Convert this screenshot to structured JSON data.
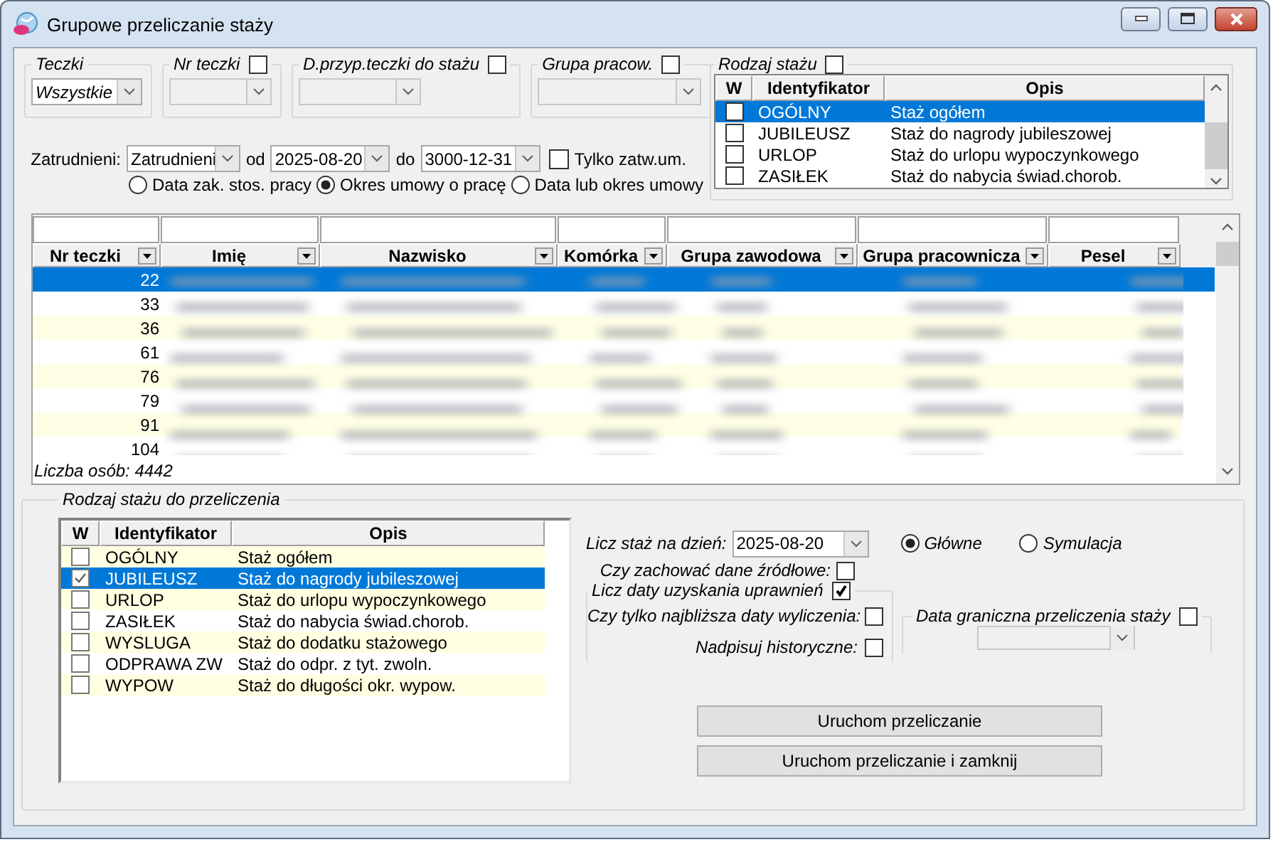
{
  "window": {
    "title": "Grupowe przeliczanie staży"
  },
  "filters": [
    {
      "legend": "Teczki",
      "value": "Wszystkie",
      "enabled": true
    },
    {
      "legend": "Nr teczki",
      "checked": false,
      "enabled": false
    },
    {
      "legend": "D.przyp.teczki do stażu",
      "checked": false,
      "enabled": false
    },
    {
      "legend": "Grupa pracow.",
      "checked": false,
      "enabled": false
    }
  ],
  "rodzaj_stazu": {
    "legend": "Rodzaj stażu",
    "checked": false,
    "columns": [
      "W",
      "Identyfikator",
      "Opis"
    ],
    "rows": [
      {
        "checked": false,
        "id": "OGÓLNY",
        "opis": "Staż ogółem",
        "selected": true
      },
      {
        "checked": false,
        "id": "JUBILEUSZ",
        "opis": "Staż do nagrody jubileszowej",
        "selected": false
      },
      {
        "checked": false,
        "id": "URLOP",
        "opis": "Staż do urlopu wypoczynkowego",
        "selected": false
      },
      {
        "checked": false,
        "id": "ZASIŁEK",
        "opis": "Staż do nabycia świad.chorob.",
        "selected": false
      }
    ]
  },
  "employment": {
    "label": "Zatrudnieni:",
    "status": "Zatrudnieni",
    "from_label": "od",
    "from": "2025-08-20",
    "to_label": "do",
    "to": "3000-12-31",
    "only_approved": {
      "label": "Tylko zatw.um.",
      "checked": false
    },
    "date_modes": [
      {
        "label": "Data zak. stos. pracy",
        "selected": false
      },
      {
        "label": "Okres umowy o pracę",
        "selected": true
      },
      {
        "label": "Data lub okres umowy",
        "selected": false
      }
    ]
  },
  "employees": {
    "columns": [
      "Nr teczki",
      "Imię",
      "Nazwisko",
      "Komórka",
      "Grupa zawodowa",
      "Grupa pracownicza",
      "Pesel"
    ],
    "rows": [
      {
        "nr": "22",
        "selected": true
      },
      {
        "nr": "33",
        "selected": false
      },
      {
        "nr": "36",
        "selected": false
      },
      {
        "nr": "61",
        "selected": false
      },
      {
        "nr": "76",
        "selected": false
      },
      {
        "nr": "79",
        "selected": false
      },
      {
        "nr": "91",
        "selected": false
      },
      {
        "nr": "104",
        "selected": false
      }
    ],
    "count": "Liczba osób: 4442"
  },
  "recalc": {
    "legend": "Rodzaj stażu do przeliczenia",
    "columns": [
      "W",
      "Identyfikator",
      "Opis"
    ],
    "rows": [
      {
        "checked": false,
        "id": "OGÓLNY",
        "opis": "Staż ogółem",
        "selected": false
      },
      {
        "checked": true,
        "id": "JUBILEUSZ",
        "opis": "Staż do nagrody jubileszowej",
        "selected": true
      },
      {
        "checked": false,
        "id": "URLOP",
        "opis": "Staż do urlopu wypoczynkowego",
        "selected": false
      },
      {
        "checked": false,
        "id": "ZASIŁEK",
        "opis": "Staż do nabycia świad.chorob.",
        "selected": false
      },
      {
        "checked": false,
        "id": "WYSLUGA",
        "opis": "Staż do dodatku stażowego",
        "selected": false
      },
      {
        "checked": false,
        "id": "ODPRAWA ZW",
        "opis": "Staż do odpr. z tyt. zwoln.",
        "selected": false
      },
      {
        "checked": false,
        "id": "WYPOW",
        "opis": "Staż do długości okr. wypow.",
        "selected": false
      }
    ]
  },
  "options": {
    "date_label": "Licz staż na dzień:",
    "date": "2025-08-20",
    "modes": [
      {
        "label": "Główne",
        "selected": true
      },
      {
        "label": "Symulacja",
        "selected": false
      }
    ],
    "keep_source": {
      "label": "Czy zachować dane źródłowe:",
      "checked": false
    },
    "entitlements": {
      "legend": "Licz daty uzyskania uprawnień",
      "checked": true,
      "nearest": {
        "label": "Czy tylko najbliższa daty wyliczenia:",
        "checked": false
      },
      "overwrite": {
        "label": "Nadpisuj historyczne:",
        "checked": false
      }
    },
    "boundary": {
      "legend": "Data graniczna przeliczenia staży",
      "checked": false,
      "enabled": false
    }
  },
  "buttons": [
    "Uruchom przeliczanie",
    "Uruchom przeliczanie i zamknij"
  ]
}
